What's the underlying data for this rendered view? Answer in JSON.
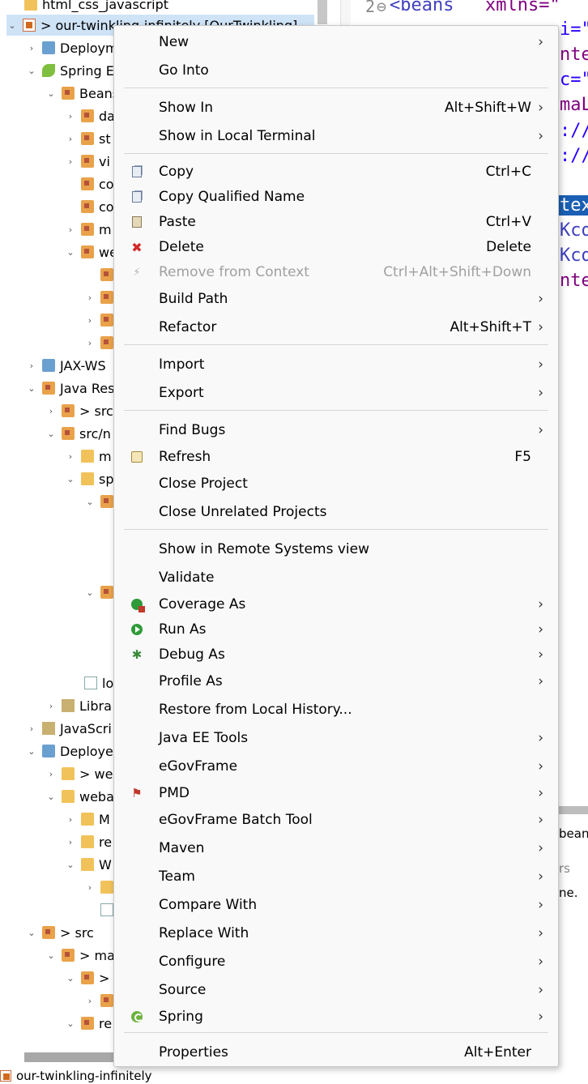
{
  "tree": {
    "rows": [
      {
        "label": "html_css_javascript"
      },
      {
        "label": "> our-twinkling-infinitely [OurTwinkling]"
      },
      {
        "label": "Deployment Descriptor"
      },
      {
        "label": "Spring Elements"
      },
      {
        "label": "Beans"
      },
      {
        "label": "da"
      },
      {
        "label": "st"
      },
      {
        "label": "vi"
      },
      {
        "label": "co"
      },
      {
        "label": "co"
      },
      {
        "label": "m"
      },
      {
        "label": "we"
      },
      {
        "label": "JAX-WS"
      },
      {
        "label": "Java Res"
      },
      {
        "label": "> src"
      },
      {
        "label": "src/n"
      },
      {
        "label": "m"
      },
      {
        "label": "sp"
      },
      {
        "label": "lo"
      },
      {
        "label": "Libra"
      },
      {
        "label": "JavaScri"
      },
      {
        "label": "Deploye"
      },
      {
        "label": "> we"
      },
      {
        "label": "weba"
      },
      {
        "label": "M"
      },
      {
        "label": "re"
      },
      {
        "label": "W"
      },
      {
        "label": "> src"
      },
      {
        "label": "> ma"
      },
      {
        "label": ">"
      },
      {
        "label": "re"
      }
    ],
    "status_text": "our-twinkling-infinitely"
  },
  "editor": {
    "line_number": "2",
    "fold_marker": "⊖",
    "code_tag": "<beans",
    "code_attr": "xmlns=\"",
    "fragments": [
      "i=\"",
      "nte",
      "c=\"",
      "maL",
      "://",
      "://",
      "tex",
      "Kco",
      "Kco",
      "nte"
    ]
  },
  "view_fragment": {
    "text1": "beans",
    "text2": "rs",
    "text3": "ne."
  },
  "menu": {
    "items": [
      {
        "label": "New",
        "shortcut": "",
        "submenu": true,
        "icon": ""
      },
      {
        "label": "Go Into",
        "shortcut": "",
        "submenu": false,
        "icon": ""
      },
      {
        "label": "Show In",
        "shortcut": "Alt+Shift+W",
        "submenu": true,
        "icon": ""
      },
      {
        "label": "Show in Local Terminal",
        "shortcut": "",
        "submenu": true,
        "icon": ""
      },
      {
        "label": "Copy",
        "shortcut": "Ctrl+C",
        "submenu": false,
        "icon": "copy-icon"
      },
      {
        "label": "Copy Qualified Name",
        "shortcut": "",
        "submenu": false,
        "icon": "copy-qualified-icon"
      },
      {
        "label": "Paste",
        "shortcut": "Ctrl+V",
        "submenu": false,
        "icon": "paste-icon"
      },
      {
        "label": "Delete",
        "shortcut": "Delete",
        "submenu": false,
        "icon": "delete-icon"
      },
      {
        "label": "Remove from Context",
        "shortcut": "Ctrl+Alt+Shift+Down",
        "submenu": false,
        "icon": "remove-icon",
        "disabled": true
      },
      {
        "label": "Build Path",
        "shortcut": "",
        "submenu": true,
        "icon": ""
      },
      {
        "label": "Refactor",
        "shortcut": "Alt+Shift+T",
        "submenu": true,
        "icon": ""
      },
      {
        "label": "Import",
        "shortcut": "",
        "submenu": true,
        "icon": ""
      },
      {
        "label": "Export",
        "shortcut": "",
        "submenu": true,
        "icon": ""
      },
      {
        "label": "Find Bugs",
        "shortcut": "",
        "submenu": true,
        "icon": ""
      },
      {
        "label": "Refresh",
        "shortcut": "F5",
        "submenu": false,
        "icon": "refresh-icon"
      },
      {
        "label": "Close Project",
        "shortcut": "",
        "submenu": false,
        "icon": ""
      },
      {
        "label": "Close Unrelated Projects",
        "shortcut": "",
        "submenu": false,
        "icon": ""
      },
      {
        "label": "Show in Remote Systems view",
        "shortcut": "",
        "submenu": false,
        "icon": ""
      },
      {
        "label": "Validate",
        "shortcut": "",
        "submenu": false,
        "icon": ""
      },
      {
        "label": "Coverage As",
        "shortcut": "",
        "submenu": true,
        "icon": "coverage-icon"
      },
      {
        "label": "Run As",
        "shortcut": "",
        "submenu": true,
        "icon": "run-icon"
      },
      {
        "label": "Debug As",
        "shortcut": "",
        "submenu": true,
        "icon": "debug-icon"
      },
      {
        "label": "Profile As",
        "shortcut": "",
        "submenu": true,
        "icon": ""
      },
      {
        "label": "Restore from Local History...",
        "shortcut": "",
        "submenu": false,
        "icon": ""
      },
      {
        "label": "Java EE Tools",
        "shortcut": "",
        "submenu": true,
        "icon": ""
      },
      {
        "label": "eGovFrame",
        "shortcut": "",
        "submenu": true,
        "icon": ""
      },
      {
        "label": "PMD",
        "shortcut": "",
        "submenu": true,
        "icon": "pmd-icon"
      },
      {
        "label": "eGovFrame Batch Tool",
        "shortcut": "",
        "submenu": true,
        "icon": ""
      },
      {
        "label": "Maven",
        "shortcut": "",
        "submenu": true,
        "icon": ""
      },
      {
        "label": "Team",
        "shortcut": "",
        "submenu": true,
        "icon": ""
      },
      {
        "label": "Compare With",
        "shortcut": "",
        "submenu": true,
        "icon": ""
      },
      {
        "label": "Replace With",
        "shortcut": "",
        "submenu": true,
        "icon": ""
      },
      {
        "label": "Configure",
        "shortcut": "",
        "submenu": true,
        "icon": ""
      },
      {
        "label": "Source",
        "shortcut": "",
        "submenu": true,
        "icon": ""
      },
      {
        "label": "Spring",
        "shortcut": "",
        "submenu": true,
        "icon": "spring-icon"
      },
      {
        "label": "Properties",
        "shortcut": "Alt+Enter",
        "submenu": false,
        "icon": ""
      }
    ],
    "arrow_glyph": "›"
  }
}
